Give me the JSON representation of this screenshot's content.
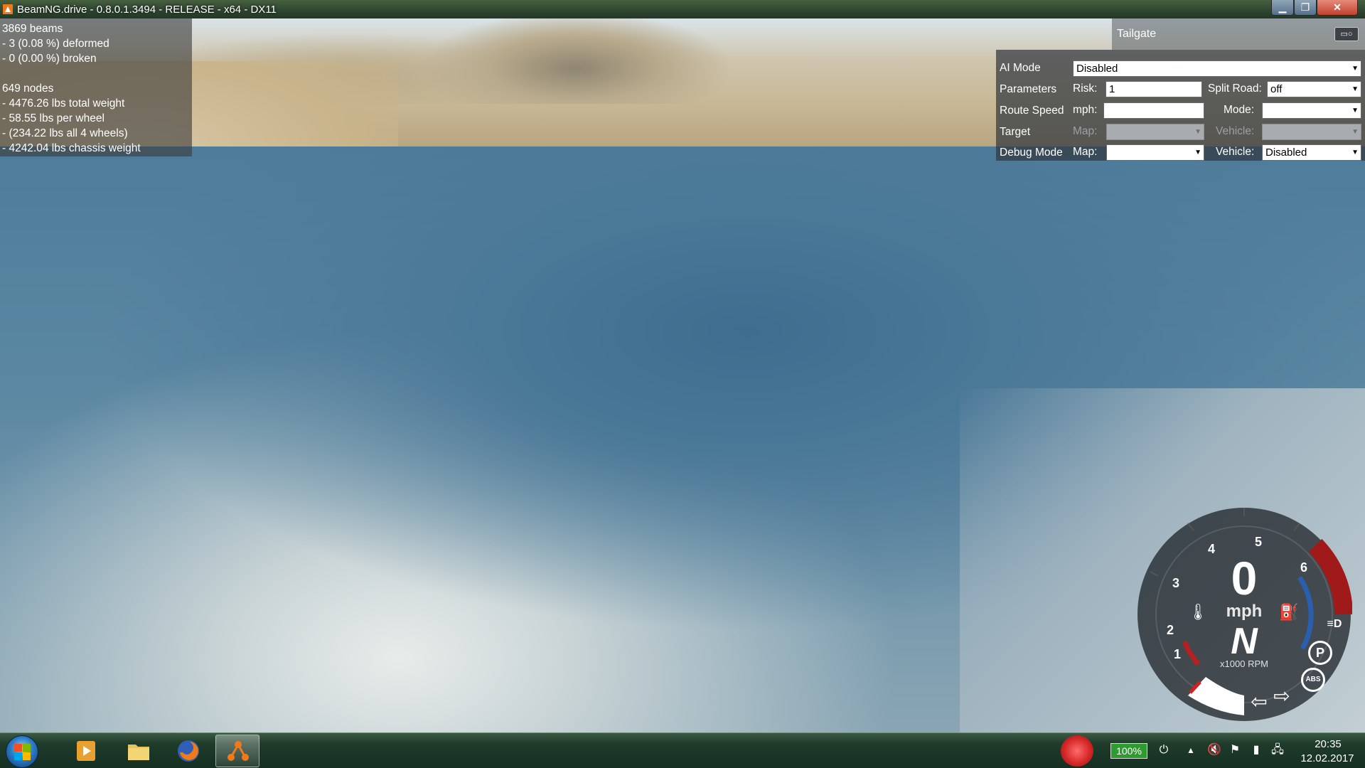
{
  "window": {
    "title": "BeamNG.drive - 0.8.0.1.3494 - RELEASE - x64 - DX11",
    "min_glyph": "▁",
    "max_glyph": "❐",
    "close_glyph": "✕"
  },
  "stats": {
    "beams": "3869 beams",
    "deformed": "- 3 (0.08 %) deformed",
    "broken": "- 0 (0.00 %) broken",
    "nodes": "649 nodes",
    "total_weight": "- 4476.26 lbs total weight",
    "per_wheel": "- 58.55 lbs per wheel",
    "all_wheels": "- (234.22 lbs all 4 wheels)",
    "chassis": "- 4242.04 lbs chassis weight"
  },
  "ai_panel": {
    "title": "Tailgate",
    "header_button": "▭○",
    "rows": {
      "ai_mode": {
        "label": "AI Mode",
        "value": "Disabled"
      },
      "parameters": {
        "label": "Parameters",
        "risk_label": "Risk:",
        "risk_value": "1",
        "split_label": "Split Road:",
        "split_value": "off"
      },
      "route_speed": {
        "label": "Route Speed",
        "mph_label": "mph:",
        "mph_value": "",
        "mode_label": "Mode:",
        "mode_value": ""
      },
      "target": {
        "label": "Target",
        "map_label": "Map:",
        "map_value": "",
        "vehicle_label": "Vehicle:",
        "vehicle_value": ""
      },
      "debug": {
        "label": "Debug Mode",
        "map_label": "Map:",
        "map_value": "",
        "vehicle_label": "Vehicle:",
        "vehicle_value": "Disabled"
      }
    },
    "dropdown_arrow": "▼"
  },
  "gauge": {
    "speed": "0",
    "unit": "mph",
    "gear": "N",
    "rpm_label": "x1000 RPM",
    "ticks": [
      "1",
      "2",
      "3",
      "4",
      "5",
      "6"
    ],
    "icons": {
      "temp": "🌡",
      "fuel": "⛽",
      "headlight": "≡D",
      "parking": "P",
      "abs": "ABS",
      "left_signal": "⇦",
      "right_signal": "⇨"
    }
  },
  "taskbar": {
    "battery": "100%",
    "time": "20:35",
    "date": "12.02.2017",
    "tray_up": "▲"
  }
}
